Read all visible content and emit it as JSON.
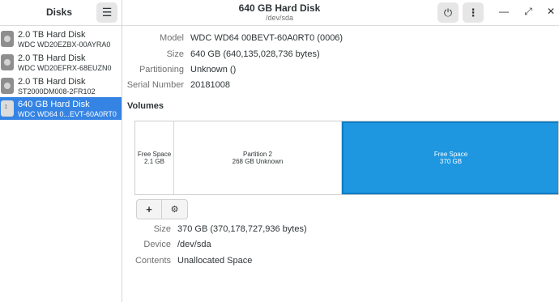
{
  "sidebar": {
    "title": "Disks",
    "menu_icon": "hamburger-icon",
    "disks": [
      {
        "name": "2.0 TB Hard Disk",
        "model": "WDC WD20EZBX-00AYRA0",
        "selected": false
      },
      {
        "name": "2.0 TB Hard Disk",
        "model": "WDC WD20EFRX-68EUZN0",
        "selected": false
      },
      {
        "name": "2.0 TB Hard Disk",
        "model": "ST2000DM008-2FR102",
        "selected": false
      },
      {
        "name": "640 GB Hard Disk",
        "model": "WDC WD64 0...EVT-60A0RT0",
        "selected": true
      }
    ]
  },
  "header": {
    "title": "640 GB Hard Disk",
    "subtitle": "/dev/sda",
    "power_icon": "power-icon",
    "menu_icon": "vertical-dots-icon",
    "minimize_icon": "minimize-icon",
    "maximize_icon": "maximize-icon",
    "close_icon": "close-icon"
  },
  "drive_info": [
    {
      "label": "Model",
      "value": "WDC WD64 00BEVT-60A0RT0 (0006)"
    },
    {
      "label": "Size",
      "value": "640 GB (640,135,028,736 bytes)"
    },
    {
      "label": "Partitioning",
      "value": "Unknown ()"
    },
    {
      "label": "Serial Number",
      "value": "20181008"
    }
  ],
  "volumes_section": {
    "title": "Volumes",
    "segments": [
      {
        "line1": "Free Space",
        "line2": "2.1 GB",
        "selected": false
      },
      {
        "line1": "Partition 2",
        "line2": "268 GB Unknown",
        "selected": false
      },
      {
        "line1": "Free Space",
        "line2": "370 GB",
        "selected": true
      }
    ],
    "add_icon": "plus-icon",
    "settings_icon": "gears-icon"
  },
  "volume_info": [
    {
      "label": "Size",
      "value": "370 GB (370,178,727,936 bytes)"
    },
    {
      "label": "Device",
      "value": "/dev/sda"
    },
    {
      "label": "Contents",
      "value": "Unallocated Space"
    }
  ],
  "colors": {
    "accent": "#3584e4",
    "selected_volume": "#1e96e0"
  }
}
